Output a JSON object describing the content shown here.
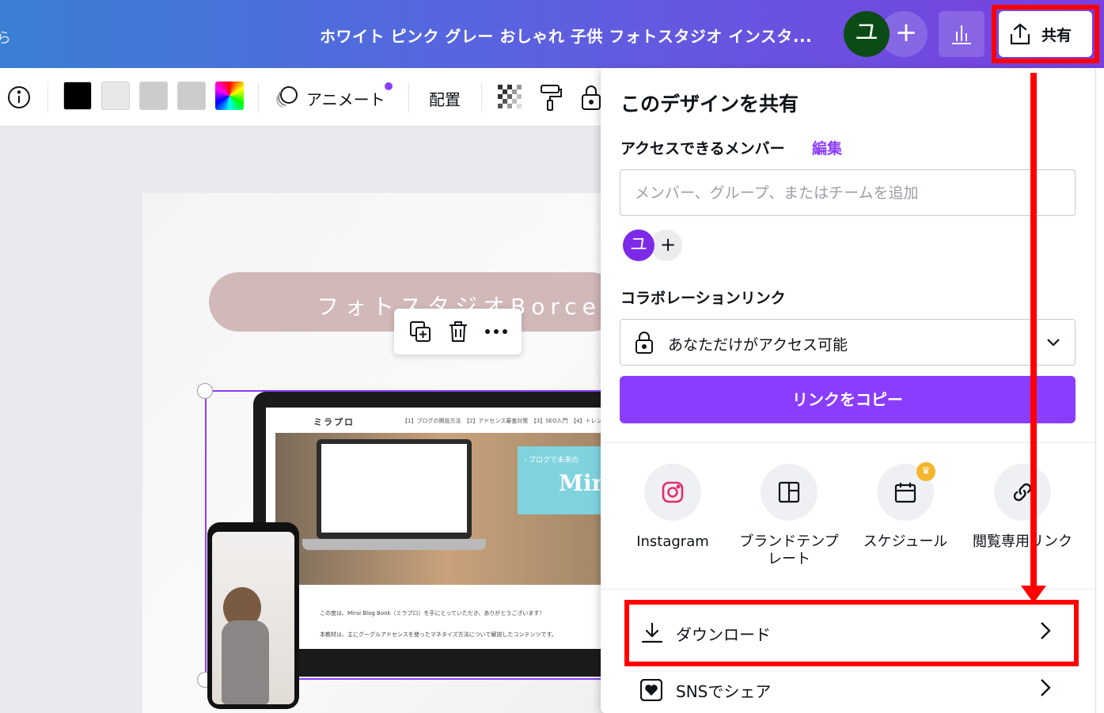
{
  "topbar": {
    "edge_glyph": "ら",
    "title": "ホワイト ピンク グレー おしゃれ 子供 フォトスタジオ インスタ...",
    "avatar_initial": "ユ",
    "add_label": "+",
    "share_label": "共有",
    "colors": {
      "gradient_start": "#3a7fd5",
      "gradient_end": "#7a3fe0"
    }
  },
  "toolbar": {
    "swatch_colors": [
      "#000000",
      "#e8e8e8",
      "#cccccc",
      "#cccccc"
    ],
    "animate_label": "アニメート",
    "arrange_label": "配置"
  },
  "canvas": {
    "pill_text": "フォトスタジオBorcelle",
    "site_logo": "ミラプロ",
    "site_nav": "【1】ブログの開設方法　【2】アドセンス審査対策　【3】SEO入門　【4】トレン",
    "hero_small": "- ブログで未来の",
    "hero_big": "Mir",
    "site_line1": "この度は、Mirai Blog Book（ミラプロ）を手にとっていただき、ありがとうございます！",
    "site_line2": "本教材は、主にグーグルアドセンスを使ったマネタイズ方法について解説したコンテンツです。"
  },
  "share_panel": {
    "title": "このデザインを共有",
    "members_label": "アクセスできるメンバー",
    "edit_label": "編集",
    "member_input_placeholder": "メンバー、グループ、またはチームを追加",
    "member_avatar": "ユ",
    "add_member": "+",
    "collab_label": "コラボレーションリンク",
    "access_value": "あなただけがアクセス可能",
    "copy_link": "リンクをコピー",
    "options": [
      {
        "label": "Instagram",
        "icon": "instagram-icon"
      },
      {
        "label": "ブランドテンプレート",
        "icon": "brand-template-icon"
      },
      {
        "label": "スケジュール",
        "icon": "calendar-icon"
      },
      {
        "label": "閲覧専用リンク",
        "icon": "link-icon"
      }
    ],
    "list": [
      {
        "label": "ダウンロード",
        "icon": "download-icon"
      },
      {
        "label": "SNSでシェア",
        "icon": "heart-icon"
      }
    ],
    "accent_color": "#8b3dff"
  },
  "annotation_color": "#ff0000"
}
